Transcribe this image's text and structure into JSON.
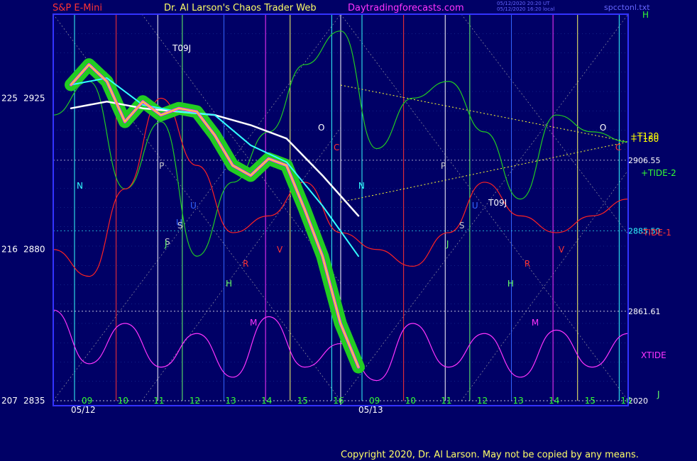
{
  "header": {
    "instrument": "S&P E-Mini",
    "site_name": "Dr. Al Larson's Chaos Trader Web",
    "site_url": "Daytradingforecasts.com",
    "timestamp_1": "05/12/2020 20:20 UT",
    "timestamp_2": "05/12/2020 16:20 local",
    "data_file": "spcctonl.txt"
  },
  "copyright": "Copyright 2020, Dr. Al Larson. May not be copied by any means.",
  "colors": {
    "background": "#000066",
    "plot_border": "#3333ff",
    "price_bar": "#ffff00",
    "price_halo": "#22cc22",
    "highlight": "#ff33ff",
    "slow_average": "#ffffff",
    "fast_average": "#33ffff",
    "tide_plus": "#22cc22",
    "tide_minus": "#ff2222",
    "xtide": "#ff33ff"
  },
  "chart_data": {
    "type": "line",
    "title": "S&P E-Mini",
    "x_axis": {
      "sessions": [
        "05/12",
        "05/13"
      ],
      "hour_ticks": [
        "09",
        "10",
        "11",
        "12",
        "13",
        "14",
        "15",
        "16",
        "09",
        "10",
        "11",
        "12",
        "13",
        "14",
        "15",
        "16"
      ]
    },
    "y_axis": {
      "range": [
        2835,
        2950
      ],
      "tick_labels": [
        {
          "left": "225",
          "price": 2925
        },
        {
          "left": "216",
          "price": 2880
        },
        {
          "left": "207",
          "price": 2835
        }
      ]
    },
    "price_levels": [
      {
        "label": "2906.55",
        "value": 2906.55,
        "color": "#ffffff"
      },
      {
        "label": "2885.50",
        "value": 2885.5,
        "color": "#33ffff"
      },
      {
        "label": "2861.61",
        "value": 2861.61,
        "color": "#ffffff"
      },
      {
        "label": "2020",
        "value": 2835,
        "color": "#ffffff"
      }
    ],
    "series_labels": [
      {
        "text": "H",
        "color": "#33ff33"
      },
      {
        "text": "+TIDE-2",
        "color": "#33ff33"
      },
      {
        "text": "-TIDE-1",
        "color": "#ff3333"
      },
      {
        "text": "XTIDE",
        "color": "#ff33ff"
      },
      {
        "text": "+T120",
        "color": "#ffff00"
      },
      {
        "text": "+T180",
        "color": "#ffff00"
      },
      {
        "text": "T09J",
        "color": "#ffffff"
      },
      {
        "text": "T09J",
        "color": "#ffffff"
      },
      {
        "text": "U",
        "color": "#3366ff"
      },
      {
        "text": "S",
        "color": "#cccccc"
      },
      {
        "text": "J",
        "color": "#66ff66"
      }
    ],
    "planet_markers": [
      "O",
      "C",
      "P",
      "N",
      "U",
      "S",
      "J",
      "R",
      "H",
      "M",
      "V"
    ],
    "price": {
      "name": "S&P E-Mini 10-min",
      "x": [
        0,
        0.5,
        1,
        1.5,
        2,
        2.5,
        3,
        3.5,
        4,
        4.5,
        5,
        5.5,
        6,
        6.5,
        7,
        7.5,
        8
      ],
      "y": [
        2929,
        2935,
        2930,
        2918,
        2924,
        2920,
        2922,
        2921,
        2914,
        2905,
        2902,
        2907,
        2905,
        2892,
        2878,
        2858,
        2845
      ]
    },
    "slow_average": {
      "x": [
        0,
        1,
        2,
        3,
        4,
        5,
        6,
        7,
        8
      ],
      "y": [
        2922,
        2924,
        2922,
        2921,
        2920,
        2917,
        2913,
        2902,
        2890
      ]
    },
    "fast_average": {
      "x": [
        0,
        1,
        2,
        3,
        4,
        5,
        6,
        7,
        8
      ],
      "y": [
        2929,
        2931,
        2923,
        2921,
        2920,
        2911,
        2906,
        2893,
        2878
      ]
    },
    "tide_plus": {
      "x": [
        0,
        1,
        2,
        3,
        4,
        5,
        6,
        7,
        8,
        9,
        10,
        11,
        12,
        13,
        14,
        15,
        16
      ],
      "y": [
        2920,
        2930,
        2898,
        2918,
        2878,
        2900,
        2915,
        2935,
        2945,
        2910,
        2925,
        2930,
        2915,
        2895,
        2920,
        2915,
        2912
      ]
    },
    "tide_minus": {
      "x": [
        0,
        1,
        2,
        3,
        4,
        5,
        6,
        7,
        8,
        9,
        10,
        11,
        12,
        13,
        14,
        15,
        16
      ],
      "y": [
        2880,
        2872,
        2898,
        2925,
        2905,
        2885,
        2890,
        2900,
        2885,
        2880,
        2875,
        2885,
        2900,
        2890,
        2885,
        2890,
        2895
      ]
    },
    "xtide": {
      "x": [
        0,
        1,
        2,
        3,
        4,
        5,
        6,
        7,
        8,
        9,
        10,
        11,
        12,
        13,
        14,
        15,
        16
      ],
      "y": [
        2862,
        2846,
        2858,
        2845,
        2855,
        2842,
        2860,
        2845,
        2852,
        2841,
        2858,
        2845,
        2855,
        2842,
        2856,
        2845,
        2855
      ]
    },
    "grid": true,
    "legend": "right"
  }
}
